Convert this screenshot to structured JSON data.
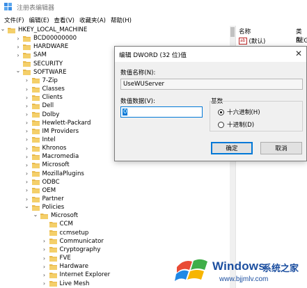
{
  "window": {
    "title": "注册表编辑器"
  },
  "menu": [
    "文件(F)",
    "编辑(E)",
    "查看(V)",
    "收藏夹(A)",
    "帮助(H)"
  ],
  "tree": [
    {
      "label": "HKEY_LOCAL_MACHINE",
      "indent": 0,
      "caret": "v"
    },
    {
      "label": "BCD00000000",
      "indent": 1,
      "caret": ">"
    },
    {
      "label": "HARDWARE",
      "indent": 1,
      "caret": ">"
    },
    {
      "label": "SAM",
      "indent": 1,
      "caret": ">"
    },
    {
      "label": "SECURITY",
      "indent": 1,
      "caret": ""
    },
    {
      "label": "SOFTWARE",
      "indent": 1,
      "caret": "v"
    },
    {
      "label": "7-Zip",
      "indent": 2,
      "caret": ">"
    },
    {
      "label": "Classes",
      "indent": 2,
      "caret": ">"
    },
    {
      "label": "Clients",
      "indent": 2,
      "caret": ">"
    },
    {
      "label": "Dell",
      "indent": 2,
      "caret": ">"
    },
    {
      "label": "Dolby",
      "indent": 2,
      "caret": ">"
    },
    {
      "label": "Hewlett-Packard",
      "indent": 2,
      "caret": ">"
    },
    {
      "label": "IM Providers",
      "indent": 2,
      "caret": ">"
    },
    {
      "label": "Intel",
      "indent": 2,
      "caret": ">"
    },
    {
      "label": "Khronos",
      "indent": 2,
      "caret": ">"
    },
    {
      "label": "Macromedia",
      "indent": 2,
      "caret": ">"
    },
    {
      "label": "Microsoft",
      "indent": 2,
      "caret": ">"
    },
    {
      "label": "MozillaPlugins",
      "indent": 2,
      "caret": ">"
    },
    {
      "label": "ODBC",
      "indent": 2,
      "caret": ">"
    },
    {
      "label": "OEM",
      "indent": 2,
      "caret": ">"
    },
    {
      "label": "Partner",
      "indent": 2,
      "caret": ">"
    },
    {
      "label": "Policies",
      "indent": 2,
      "caret": "v"
    },
    {
      "label": "Microsoft",
      "indent": 3,
      "caret": "v"
    },
    {
      "label": "CCM",
      "indent": 4,
      "caret": ""
    },
    {
      "label": "ccmsetup",
      "indent": 4,
      "caret": ""
    },
    {
      "label": "Communicator",
      "indent": 4,
      "caret": ">"
    },
    {
      "label": "Cryptography",
      "indent": 4,
      "caret": ">"
    },
    {
      "label": "FVE",
      "indent": 4,
      "caret": ">"
    },
    {
      "label": "Hardware",
      "indent": 4,
      "caret": ">"
    },
    {
      "label": "Internet Explorer",
      "indent": 4,
      "caret": ">"
    },
    {
      "label": "Live Mesh",
      "indent": 4,
      "caret": ">"
    }
  ],
  "right_pane": {
    "col_name": "名称",
    "col_type": "类型",
    "row_name": "(默认)",
    "row_type": "REG",
    "icon": "ab-value-icon"
  },
  "dialog": {
    "title": "编辑 DWORD (32 位)值",
    "value_name_label": "数值名称(N):",
    "value_name": "UseWUServer",
    "value_data_label": "数值数据(V):",
    "value_data": "0",
    "base_label": "基数",
    "hex_label": "十六进制(H)",
    "dec_label": "十进制(D)",
    "selected_base": "hex",
    "ok_label": "确定",
    "cancel_label": "取消"
  },
  "watermark": {
    "brand": "Windows",
    "cn": "系统之家",
    "url": "www.bjjmlv.com",
    "colors": {
      "red": "#e94b35",
      "green": "#3fae49",
      "blue": "#1e88e5",
      "yellow": "#f7b500"
    }
  }
}
